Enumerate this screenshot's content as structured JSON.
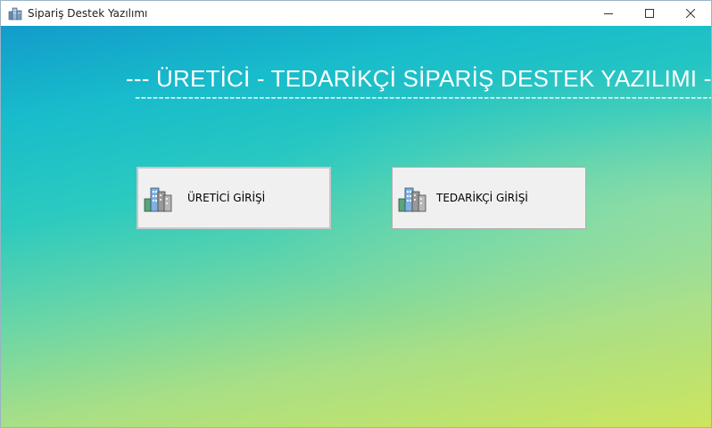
{
  "window": {
    "title": "Sipariş Destek Yazılımı",
    "icon": "buildings-icon"
  },
  "controls": {
    "minimize": "minimize-icon",
    "maximize": "maximize-icon",
    "close": "close-icon"
  },
  "header": {
    "title": "--- ÜRETİCİ - TEDARİKÇİ SİPARİŞ DESTEK YAZILIMI ---",
    "underline": "--------------------------------------------------------------------------------------------------------"
  },
  "buttons": {
    "uretici_label": "ÜRETİCİ GİRİŞİ",
    "tedarikci_label": "TEDARİKÇİ GİRİŞİ",
    "icon": "buildings-icon"
  },
  "colors": {
    "gradient_top": "#129ccb",
    "gradient_mid": "#2ccabf",
    "gradient_bottom": "#cde55f",
    "button_face": "#f0f0f0"
  }
}
